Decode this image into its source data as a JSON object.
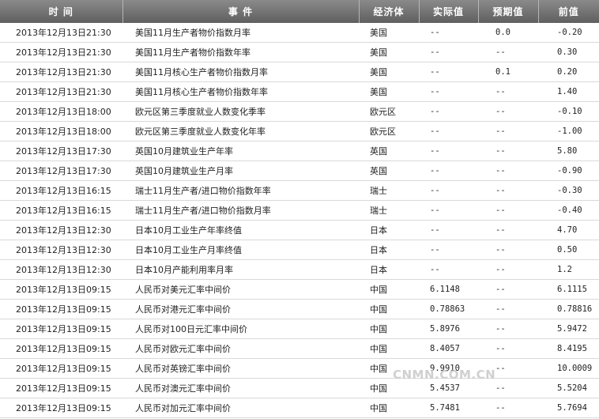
{
  "header": {
    "time": "时 间",
    "event": "事 件",
    "economy": "经济体",
    "actual": "实际值",
    "forecast": "预期值",
    "previous": "前值"
  },
  "rows": [
    {
      "time": "2013年12月13日21:30",
      "event": "美国11月生产者物价指数月率",
      "economy": "美国",
      "actual": "--",
      "forecast": "0.0",
      "previous": "-0.20"
    },
    {
      "time": "2013年12月13日21:30",
      "event": "美国11月生产者物价指数年率",
      "economy": "美国",
      "actual": "--",
      "forecast": "--",
      "previous": "0.30"
    },
    {
      "time": "2013年12月13日21:30",
      "event": "美国11月核心生产者物价指数月率",
      "economy": "美国",
      "actual": "--",
      "forecast": "0.1",
      "previous": "0.20"
    },
    {
      "time": "2013年12月13日21:30",
      "event": "美国11月核心生产者物价指数年率",
      "economy": "美国",
      "actual": "--",
      "forecast": "--",
      "previous": "1.40"
    },
    {
      "time": "2013年12月13日18:00",
      "event": "欧元区第三季度就业人数变化季率",
      "economy": "欧元区",
      "actual": "--",
      "forecast": "--",
      "previous": "-0.10"
    },
    {
      "time": "2013年12月13日18:00",
      "event": "欧元区第三季度就业人数变化年率",
      "economy": "欧元区",
      "actual": "--",
      "forecast": "--",
      "previous": "-1.00"
    },
    {
      "time": "2013年12月13日17:30",
      "event": "英国10月建筑业生产年率",
      "economy": "英国",
      "actual": "--",
      "forecast": "--",
      "previous": "5.80"
    },
    {
      "time": "2013年12月13日17:30",
      "event": "英国10月建筑业生产月率",
      "economy": "英国",
      "actual": "--",
      "forecast": "--",
      "previous": "-0.90"
    },
    {
      "time": "2013年12月13日16:15",
      "event": "瑞士11月生产者/进口物价指数年率",
      "economy": "瑞士",
      "actual": "--",
      "forecast": "--",
      "previous": "-0.30"
    },
    {
      "time": "2013年12月13日16:15",
      "event": "瑞士11月生产者/进口物价指数月率",
      "economy": "瑞士",
      "actual": "--",
      "forecast": "--",
      "previous": "-0.40"
    },
    {
      "time": "2013年12月13日12:30",
      "event": "日本10月工业生产年率终值",
      "economy": "日本",
      "actual": "--",
      "forecast": "--",
      "previous": "4.70"
    },
    {
      "time": "2013年12月13日12:30",
      "event": "日本10月工业生产月率终值",
      "economy": "日本",
      "actual": "--",
      "forecast": "--",
      "previous": "0.50"
    },
    {
      "time": "2013年12月13日12:30",
      "event": "日本10月产能利用率月率",
      "economy": "日本",
      "actual": "--",
      "forecast": "--",
      "previous": "1.2"
    },
    {
      "time": "2013年12月13日09:15",
      "event": "人民币对美元汇率中间价",
      "economy": "中国",
      "actual": "6.1148",
      "forecast": "--",
      "previous": "6.1115"
    },
    {
      "time": "2013年12月13日09:15",
      "event": "人民币对港元汇率中间价",
      "economy": "中国",
      "actual": "0.78863",
      "forecast": "--",
      "previous": "0.78816"
    },
    {
      "time": "2013年12月13日09:15",
      "event": "人民币对100日元汇率中间价",
      "economy": "中国",
      "actual": "5.8976",
      "forecast": "--",
      "previous": "5.9472"
    },
    {
      "time": "2013年12月13日09:15",
      "event": "人民币对欧元汇率中间价",
      "economy": "中国",
      "actual": "8.4057",
      "forecast": "--",
      "previous": "8.4195"
    },
    {
      "time": "2013年12月13日09:15",
      "event": "人民币对英镑汇率中间价",
      "economy": "中国",
      "actual": "9.9910",
      "forecast": "--",
      "previous": "10.0009"
    },
    {
      "time": "2013年12月13日09:15",
      "event": "人民币对澳元汇率中间价",
      "economy": "中国",
      "actual": "5.4537",
      "forecast": "--",
      "previous": "5.5204"
    },
    {
      "time": "2013年12月13日09:15",
      "event": "人民币对加元汇率中间价",
      "economy": "中国",
      "actual": "5.7481",
      "forecast": "--",
      "previous": "5.7694"
    }
  ],
  "watermark": "CNMN.COM.CN"
}
